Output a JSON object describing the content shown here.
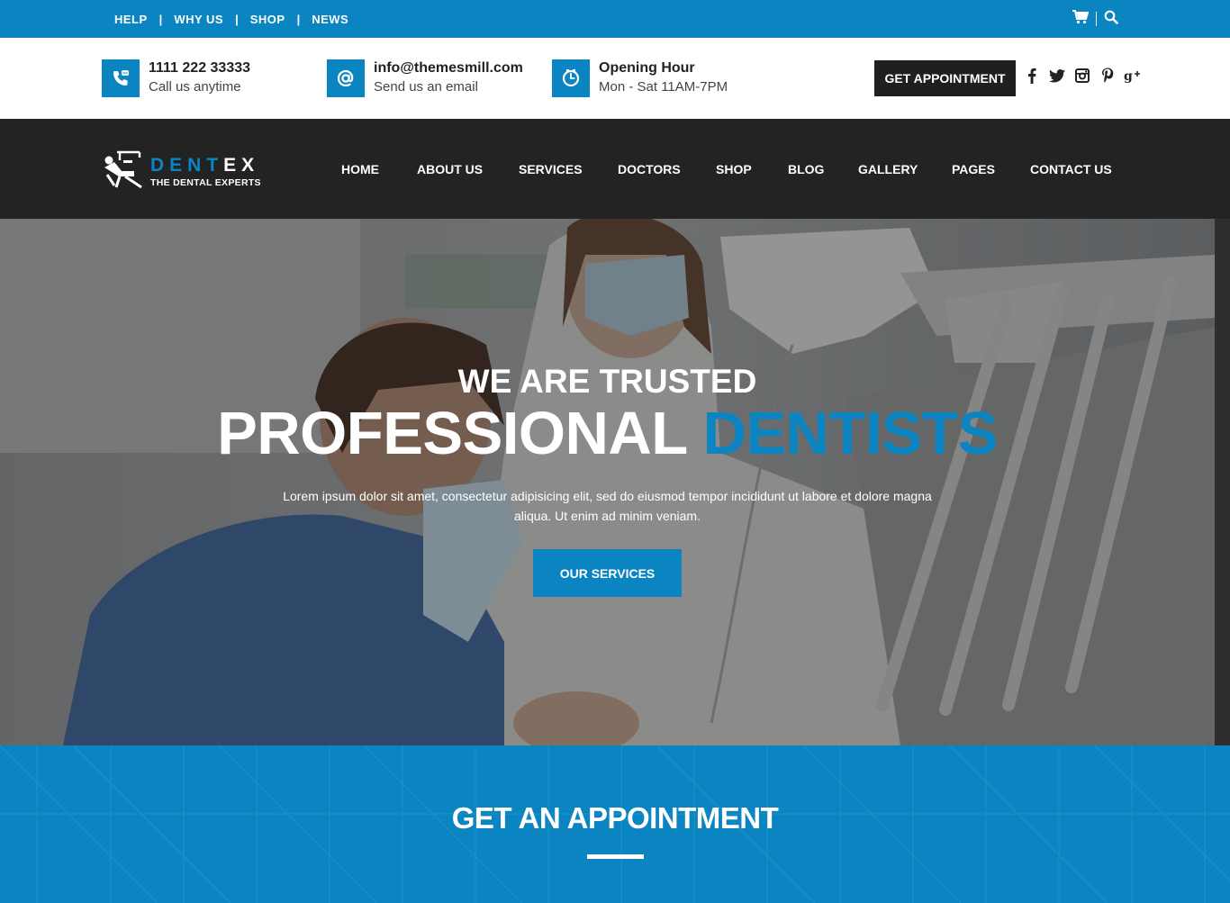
{
  "topbar": {
    "links": [
      "HELP",
      "WHY US",
      "SHOP",
      "NEWS"
    ],
    "separator": "|",
    "icons": [
      "cart-icon",
      "search-icon"
    ]
  },
  "contact": {
    "phone": {
      "title": "1111 222 33333",
      "subtitle": "Call us anytime",
      "icon": "phone-icon"
    },
    "email": {
      "title": "info@themesmill.com",
      "subtitle": "Send us an email",
      "icon": "at-icon"
    },
    "hours": {
      "title": "Opening Hour",
      "subtitle": "Mon - Sat 11AM-7PM",
      "icon": "clock-icon"
    },
    "button": "GET APPOINTMENT",
    "social": [
      "facebook-icon",
      "twitter-icon",
      "instagram-icon",
      "pinterest-icon",
      "google-plus-icon"
    ]
  },
  "nav": {
    "logo": {
      "name_blue": "DENT",
      "name_white": "EX",
      "tagline": "THE DENTAL EXPERTS"
    },
    "items": [
      "HOME",
      "ABOUT US",
      "SERVICES",
      "DOCTORS",
      "SHOP",
      "BLOG",
      "GALLERY",
      "PAGES",
      "CONTACT US"
    ]
  },
  "hero": {
    "kicker": "WE ARE TRUSTED",
    "title_white": "PROFESSIONAL",
    "title_blue": "DENTISTS",
    "description_line1": "Lorem ipsum dolor sit amet, consectetur adipisicing elit, sed do eiusmod tempor incididunt ut labore et dolore magna",
    "description_line2": "aliqua. Ut enim ad minim veniam.",
    "button": "OUR SERVICES"
  },
  "appointment": {
    "title": "GET AN APPOINTMENT"
  },
  "colors": {
    "brand": "#0a85c2",
    "dark": "#232323",
    "white": "#ffffff"
  }
}
